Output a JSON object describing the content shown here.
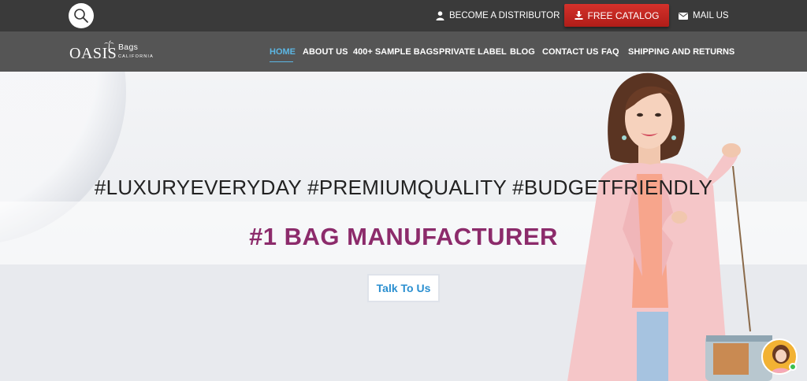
{
  "topbar": {
    "distributor_label": "BECOME A DISTRIBUTOR",
    "catalog_label": "FREE CATALOG",
    "mail_label": "MAIL US"
  },
  "logo": {
    "main": "OASIS",
    "bags": "Bags",
    "sub": "CALIFORNIA"
  },
  "nav": {
    "items": [
      {
        "label": "HOME",
        "active": true
      },
      {
        "label": "ABOUT US"
      },
      {
        "label": "400+ SAMPLE BAGS"
      },
      {
        "label": "PRIVATE LABEL"
      },
      {
        "label": "BLOG"
      },
      {
        "label": "CONTACT US"
      },
      {
        "label": "FAQ"
      },
      {
        "label": "SHIPPING AND RETURNS"
      }
    ]
  },
  "hero": {
    "hashtags": "#LUXURYEVERYDAY #PREMIUMQUALITY #BUDGETFRIENDLY",
    "headline": "#1 BAG MANUFACTURER",
    "cta_label": "Talk To Us"
  },
  "colors": {
    "topbar_bg": "#3a3a3a",
    "navbar_bg": "#555555",
    "nav_active": "#5cb6e3",
    "catalog_red": "#c6261f",
    "headline_purple": "#8c2b6b",
    "cta_blue": "#2a8fd0"
  },
  "icons": [
    "search-icon",
    "user-icon",
    "download-icon",
    "mail-icon",
    "palm-tree-icon"
  ]
}
